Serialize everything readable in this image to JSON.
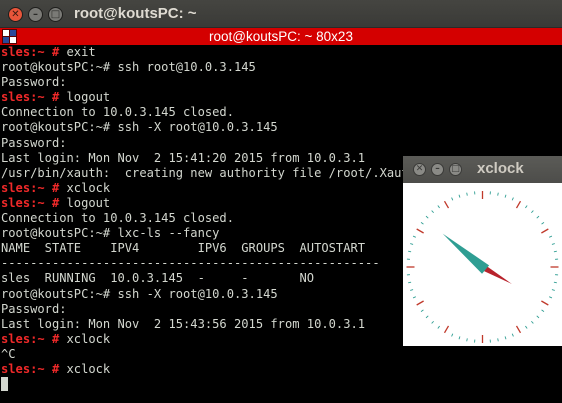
{
  "terminal": {
    "window_title": "root@koutsPC: ~",
    "tab_title": "root@koutsPC: ~ 80x23",
    "colors": {
      "prompt": "#ef2929",
      "text": "#d3d7cf",
      "tabbar": "#d40000"
    },
    "lines": [
      {
        "prompt": "sles:~ # ",
        "text": "exit"
      },
      {
        "prompt": "",
        "text": "root@koutsPC:~# ssh root@10.0.3.145"
      },
      {
        "prompt": "",
        "text": "Password:"
      },
      {
        "prompt": "sles:~ # ",
        "text": "logout"
      },
      {
        "prompt": "",
        "text": "Connection to 10.0.3.145 closed."
      },
      {
        "prompt": "",
        "text": "root@koutsPC:~# ssh -X root@10.0.3.145"
      },
      {
        "prompt": "",
        "text": "Password:"
      },
      {
        "prompt": "",
        "text": "Last login: Mon Nov  2 15:41:20 2015 from 10.0.3.1"
      },
      {
        "prompt": "",
        "text": "/usr/bin/xauth:  creating new authority file /root/.Xauthority"
      },
      {
        "prompt": "sles:~ # ",
        "text": "xclock"
      },
      {
        "prompt": "sles:~ # ",
        "text": "logout"
      },
      {
        "prompt": "",
        "text": "Connection to 10.0.3.145 closed."
      },
      {
        "prompt": "",
        "text": "root@koutsPC:~# lxc-ls --fancy"
      },
      {
        "prompt": "",
        "text": "NAME  STATE    IPV4        IPV6  GROUPS  AUTOSTART"
      },
      {
        "prompt": "",
        "text": "----------------------------------------------------"
      },
      {
        "prompt": "",
        "text": "sles  RUNNING  10.0.3.145  -     -       NO"
      },
      {
        "prompt": "",
        "text": "root@koutsPC:~# ssh -X root@10.0.3.145"
      },
      {
        "prompt": "",
        "text": "Password:"
      },
      {
        "prompt": "",
        "text": "Last login: Mon Nov  2 15:43:56 2015 from 10.0.3.1"
      },
      {
        "prompt": "sles:~ # ",
        "text": "xclock"
      },
      {
        "prompt": "",
        "text": "^C"
      },
      {
        "prompt": "sles:~ # ",
        "text": "xclock"
      }
    ]
  },
  "xclock": {
    "window_title": "xclock",
    "time": {
      "hour": 10,
      "minute": 20
    },
    "colors": {
      "hour_hand": "#2f9e93",
      "minute_hand": "#b8232c",
      "tick_hour": "#c0392b",
      "tick_minute": "#2f9e93"
    }
  }
}
